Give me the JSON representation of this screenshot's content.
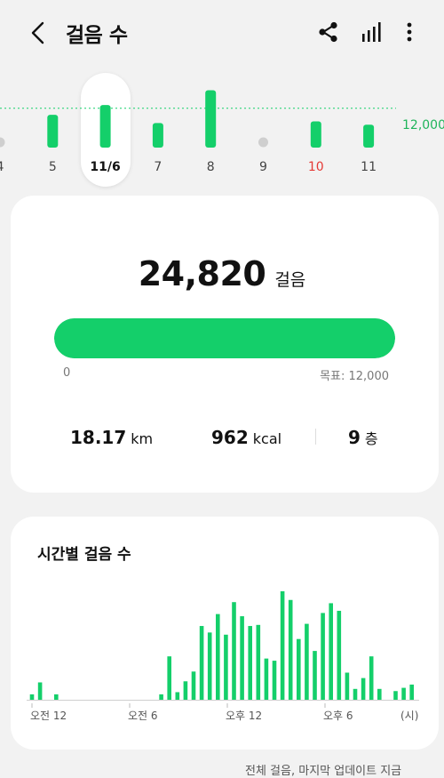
{
  "header": {
    "title": "걸음 수",
    "back_icon": "chevron-left-icon",
    "share_icon": "share-icon",
    "chart_icon": "bar-chart-icon",
    "more_icon": "more-vertical-icon"
  },
  "daily": {
    "goal_label": "12,000",
    "goal": 12000,
    "max": 19000,
    "days": [
      {
        "label": "4",
        "value": 0,
        "has_data": false,
        "color": "#444444"
      },
      {
        "label": "5",
        "value": 10000,
        "has_data": true,
        "color": "#444444"
      },
      {
        "label": "11/6",
        "value": 13000,
        "has_data": true,
        "selected": true,
        "color": "#111111"
      },
      {
        "label": "7",
        "value": 7500,
        "has_data": true,
        "color": "#444444"
      },
      {
        "label": "8",
        "value": 17500,
        "has_data": true,
        "color": "#444444"
      },
      {
        "label": "9",
        "value": 0,
        "has_data": false,
        "color": "#444444"
      },
      {
        "label": "10",
        "value": 8000,
        "has_data": true,
        "color": "#e53935"
      },
      {
        "label": "11",
        "value": 7000,
        "has_data": true,
        "color": "#444444"
      }
    ]
  },
  "summary": {
    "steps": "24,820",
    "steps_unit": "걸음",
    "progress": 1.0,
    "bar_min": "0",
    "bar_goal": "목표: 12,000",
    "distance": "18.17",
    "distance_unit": "km",
    "calories": "962",
    "calories_unit": "kcal",
    "floors": "9",
    "floors_unit": "층"
  },
  "hourly": {
    "title": "시간별 걸음 수",
    "axis_labels": [
      "오전 12",
      "오전 6",
      "오후 12",
      "오후 6",
      "(시)"
    ]
  },
  "chart_data": {
    "type": "bar",
    "title": "시간별 걸음 수",
    "xlabel": "(시)",
    "ylabel": "",
    "max": 1000,
    "values": [
      50,
      160,
      0,
      50,
      0,
      0,
      0,
      0,
      0,
      0,
      0,
      0,
      0,
      0,
      0,
      0,
      50,
      400,
      70,
      170,
      260,
      680,
      620,
      790,
      600,
      900,
      770,
      680,
      690,
      380,
      360,
      1000,
      920,
      560,
      700,
      450,
      800,
      890,
      820,
      250,
      100,
      200,
      400,
      100,
      0,
      80,
      110,
      140,
      0,
      0,
      0,
      0,
      50
    ]
  },
  "footer": {
    "text": "전체 걸음, 마지막 업데이트 지금"
  },
  "colors": {
    "accent": "#14cf6a",
    "background": "#f2f2f2",
    "card": "#ffffff",
    "weekend": "#e53935"
  }
}
